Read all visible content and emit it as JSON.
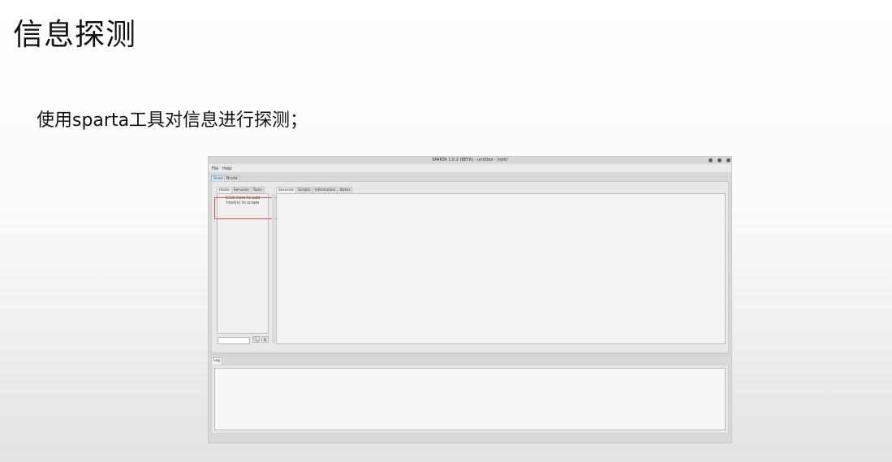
{
  "slide": {
    "title": "信息探测",
    "subtitle": "使用sparta工具对信息进行探测；"
  },
  "app": {
    "window_title": "SPARTA 1.0.2 (BETA) - untitled - /root/",
    "menu": [
      "File",
      "Help"
    ],
    "mode_tabs": [
      "Scan",
      "Brute"
    ],
    "left_tabs": [
      "Hosts",
      "Services",
      "Tools"
    ],
    "right_tabs": [
      "Services",
      "Scripts",
      "Information",
      "Notes"
    ],
    "add_host_text_line1": "Click here to add",
    "add_host_text_line2": "host(s) to scope",
    "log_tab": "Log",
    "search_icon": "search-icon",
    "filter_icon": "filter-icon",
    "search_glyph": "🔍",
    "filter_glyph": "⇅",
    "colors": {
      "highlight_border": "#e05050",
      "active_mode_tab": "#1e5a96"
    }
  }
}
